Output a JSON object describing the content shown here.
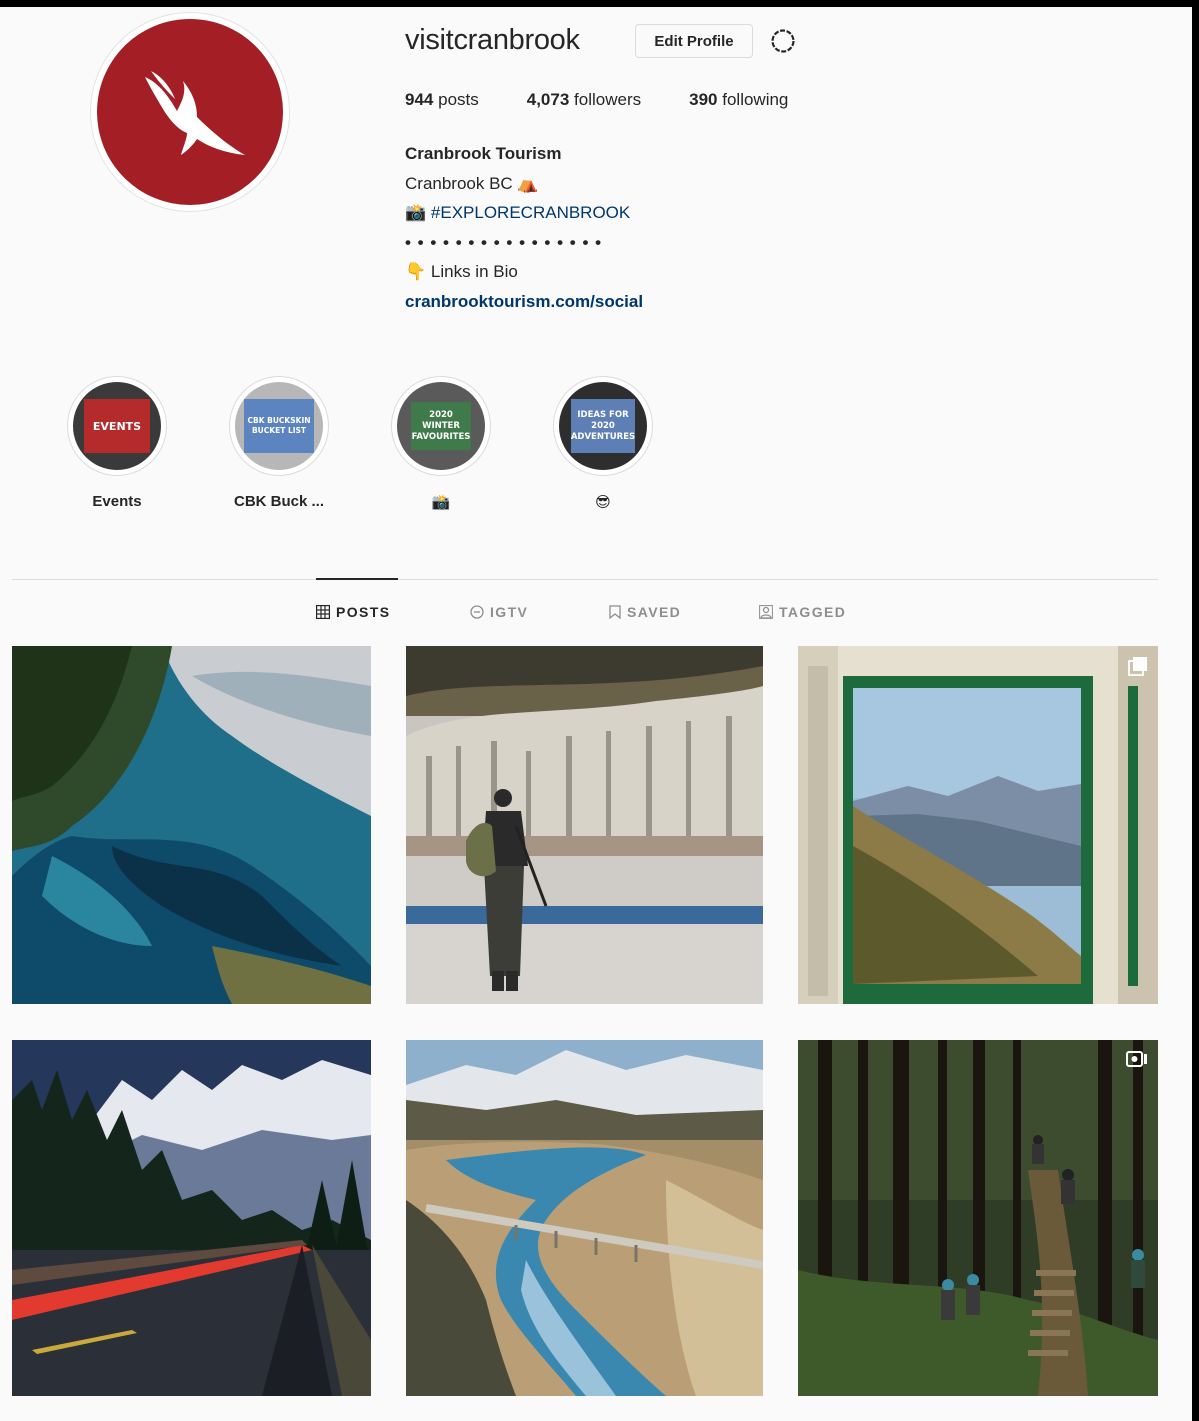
{
  "profile": {
    "username": "visitcranbrook",
    "edit_label": "Edit Profile",
    "stats": {
      "posts": "944",
      "posts_label": "posts",
      "followers": "4,073",
      "followers_label": "followers",
      "following": "390",
      "following_label": "following"
    },
    "bio": {
      "name": "Cranbrook Tourism",
      "location": "Cranbrook BC ⛺",
      "hashtag": "#EXPLORECRANBROOK",
      "hashtag_prefix": "📸",
      "divider": "• • • • • • • • • • • • • • • •",
      "links_text": "👇 Links in Bio",
      "url": "cranbrooktourism.com/social"
    },
    "brand_color": "#a41e25"
  },
  "highlights": [
    {
      "label": "Events",
      "card_text": "EVENTS",
      "card_color": "#b52a2a"
    },
    {
      "label": "CBK Buck ...",
      "card_text": "CBK BUCKSKIN BUCKET LIST",
      "card_color": "#5b84c0"
    },
    {
      "label": "📸",
      "card_text": "2020 WINTER FAVOURITES",
      "card_color": "#3f7a4a"
    },
    {
      "label": "😎",
      "card_text": "IDEAS FOR 2020 ADVENTURES",
      "card_color": "#5e7fb6"
    }
  ],
  "tabs": [
    {
      "label": "POSTS",
      "icon": "grid-icon",
      "active": true
    },
    {
      "label": "IGTV",
      "icon": "igtv-icon",
      "active": false
    },
    {
      "label": "SAVED",
      "icon": "bookmark-icon",
      "active": false
    },
    {
      "label": "TAGGED",
      "icon": "tag-person-icon",
      "active": false
    }
  ],
  "posts": [
    {
      "subject": "aerial lake shoreline",
      "badge": ""
    },
    {
      "subject": "angler walking riverbed",
      "badge": ""
    },
    {
      "subject": "mountain view through window",
      "badge": "carousel-icon"
    },
    {
      "subject": "highway at night mountains",
      "badge": ""
    },
    {
      "subject": "river bridge aerial",
      "badge": ""
    },
    {
      "subject": "forest bike trail",
      "badge": "video-icon"
    }
  ]
}
